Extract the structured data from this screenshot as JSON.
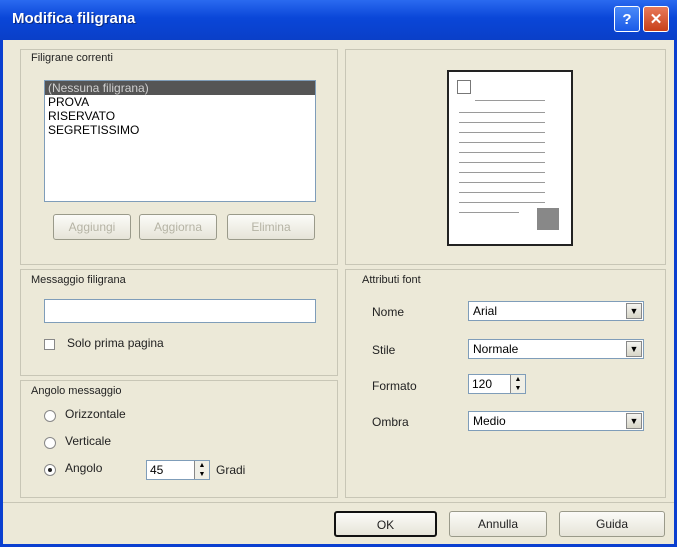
{
  "window": {
    "title": "Modifica filigrana",
    "help_label": "?",
    "close_label": "✕"
  },
  "current": {
    "legend": "Filigrane correnti",
    "items": [
      "(Nessuna filigrana)",
      "PROVA",
      "RISERVATO",
      "SEGRETISSIMO"
    ],
    "selected_index": 0,
    "buttons": [
      "Aggiungi",
      "Aggiorna",
      "Elimina"
    ]
  },
  "message": {
    "legend": "Messaggio filigrana",
    "value": "",
    "first_page_label": "Solo prima pagina",
    "first_page_checked": false
  },
  "angle": {
    "legend": "Angolo messaggio",
    "options": [
      "Orizzontale",
      "Verticale",
      "Angolo"
    ],
    "selected": "Angolo",
    "degrees": "45",
    "degrees_label": "Gradi"
  },
  "font": {
    "legend": "Attributi font",
    "name_label": "Nome",
    "name_value": "Arial",
    "style_label": "Stile",
    "style_value": "Normale",
    "size_label": "Formato",
    "size_value": "120",
    "shade_label": "Ombra",
    "shade_value": "Medio"
  },
  "footer": {
    "ok_label": "OK",
    "cancel_label": "Annulla",
    "help_label": "Guida"
  }
}
